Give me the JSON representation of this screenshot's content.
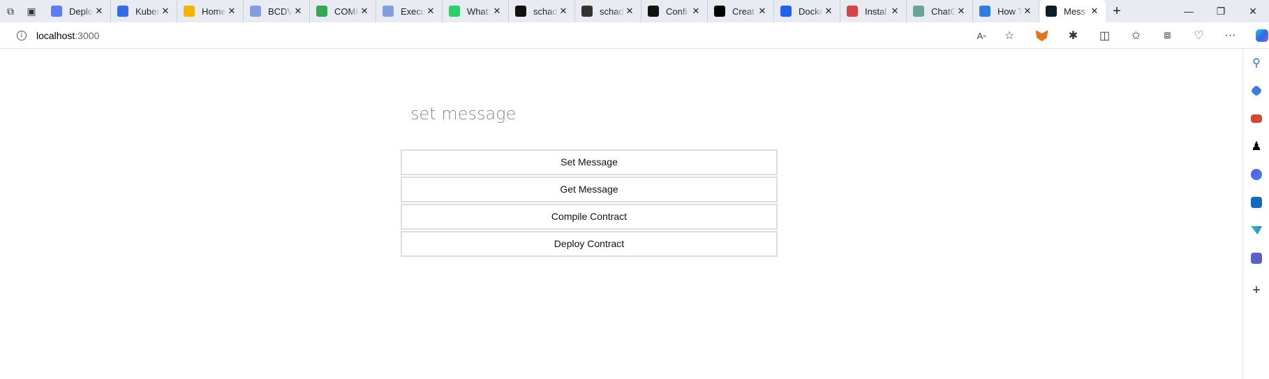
{
  "browser": {
    "tabs": [
      {
        "label": "Deplo",
        "icon": "diamond-icon",
        "color": "#5b7cf6"
      },
      {
        "label": "Kuber",
        "icon": "kubernetes-icon",
        "color": "#326ce5"
      },
      {
        "label": "Home",
        "icon": "google-drive-icon",
        "color": "#f4b400"
      },
      {
        "label": "BCDV",
        "icon": "google-docs-icon",
        "color": "#7f9fe0"
      },
      {
        "label": "COMP",
        "icon": "google-drive-icon",
        "color": "#34a853"
      },
      {
        "label": "Execu",
        "icon": "google-docs-icon",
        "color": "#7f9fe0"
      },
      {
        "label": "What:",
        "icon": "whatsapp-icon",
        "color": "#25d366"
      },
      {
        "label": "schad",
        "icon": "github-icon",
        "color": "#111111"
      },
      {
        "label": "schad",
        "icon": "github-icon",
        "color": "#333333"
      },
      {
        "label": "Confi",
        "icon": "github-icon",
        "color": "#111111"
      },
      {
        "label": "Creat",
        "icon": "medium-icon",
        "color": "#000000"
      },
      {
        "label": "Docke",
        "icon": "docker-icon",
        "color": "#1d63ed"
      },
      {
        "label": "Instal",
        "icon": "install-icon",
        "color": "#d64545"
      },
      {
        "label": "ChatG",
        "icon": "chatgpt-icon",
        "color": "#6aa39a"
      },
      {
        "label": "How T",
        "icon": "edge-icon",
        "color": "#2f7de1"
      },
      {
        "label": "Mess",
        "icon": "react-icon",
        "color": "#0b1f24",
        "active": true
      }
    ],
    "address": {
      "host": "localhost",
      "port": ":3000"
    },
    "accent_color": "#0b57d0"
  },
  "page": {
    "message_placeholder": "set message",
    "buttons": {
      "set_message": "Set Message",
      "get_message": "Get Message",
      "compile_contract": "Compile Contract",
      "deploy_contract": "Deploy Contract"
    }
  }
}
